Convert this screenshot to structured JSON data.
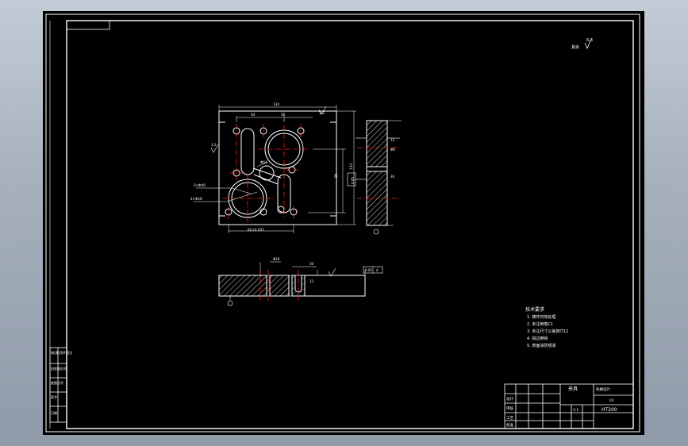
{
  "drawing": {
    "roughness_note": "其余",
    "roughness_symbol": "√",
    "roughness_values": [
      "6.3",
      "1.6",
      "3.2"
    ]
  },
  "dimensions": {
    "top_width": "134",
    "top_sub_left": "44",
    "top_sub_right": "56",
    "right_height": "96",
    "bottom_span": "82±0.037",
    "hole1": "2×Φ40",
    "hole2": "2×Φ18",
    "diam_mid": "Φ64",
    "section_depth": "30",
    "section_width": "Φ18",
    "side_dim1": "12",
    "side_dim2": "Φ8",
    "flatness_label": "0.05",
    "datum": "A"
  },
  "technical_requirements": {
    "title": "技术要求",
    "items": [
      "1. 铸件时效处理",
      "2. 未注倒角C1",
      "3. 未注尺寸公差按IT12",
      "4. 锐边倒钝",
      "5. 表面涂防锈漆"
    ]
  },
  "title_block": {
    "part_name": "夹具",
    "material": "HT200",
    "scale": "1:1",
    "drawing_no": "01",
    "school": "机械设计",
    "rows": [
      "设计",
      "审核",
      "工艺",
      "批准"
    ]
  },
  "revision_block": {
    "labels": [
      "借(通)用件登记",
      "旧底图总号",
      "底图总号",
      "签字",
      "日期"
    ]
  },
  "colors": {
    "line": "#ffffff",
    "center_line": "#ff2020",
    "dimension": "#ffffff",
    "background": "#000000"
  }
}
